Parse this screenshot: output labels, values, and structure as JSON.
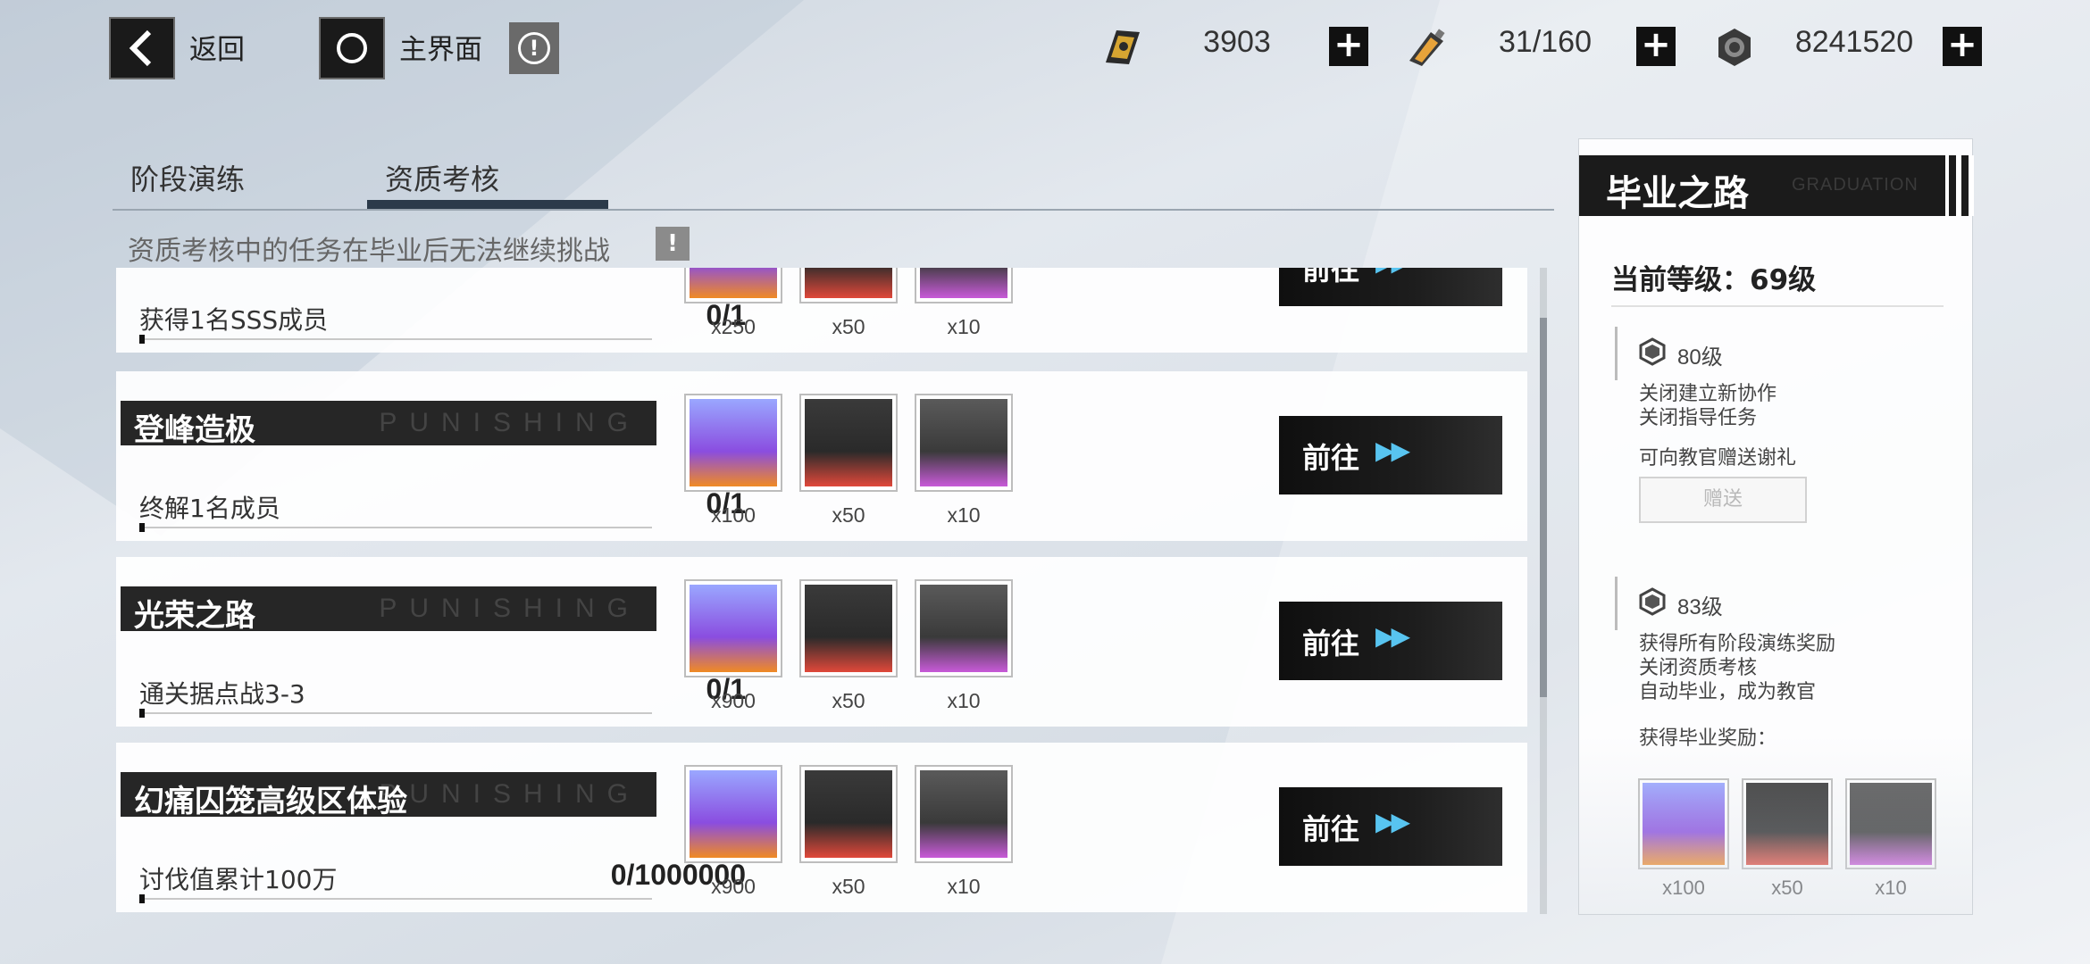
{
  "topbar": {
    "back_label": "返回",
    "home_label": "主界面",
    "resources": [
      {
        "icon": "ticket-icon",
        "value": "3903"
      },
      {
        "icon": "battery-icon",
        "value": "31/160"
      },
      {
        "icon": "gear-coin-icon",
        "value": "8241520"
      }
    ]
  },
  "tabs": [
    {
      "label": "阶段演练",
      "active": false
    },
    {
      "label": "资质考核",
      "active": true
    }
  ],
  "notice": "资质考核中的任务在毕业后无法继续挑战",
  "tasks": [
    {
      "title": "",
      "desc": "获得1名SSS成员",
      "progress": "0/1",
      "rewards": [
        "x250",
        "x50",
        "x10"
      ],
      "button": "前往"
    },
    {
      "title": "登峰造极",
      "deco": "PUNISHING",
      "desc": "终解1名成员",
      "progress": "0/1",
      "rewards": [
        "x100",
        "x50",
        "x10"
      ],
      "button": "前往"
    },
    {
      "title": "光荣之路",
      "deco": "PUNISHING",
      "desc": "通关据点战3-3",
      "progress": "0/1",
      "rewards": [
        "x900",
        "x50",
        "x10"
      ],
      "button": "前往"
    },
    {
      "title": "幻痛囚笼高级区体验",
      "deco": "PUNISHING",
      "desc": "讨伐值累计100万",
      "progress": "0/1000000",
      "rewards": [
        "x900",
        "x50",
        "x10"
      ],
      "button": "前往"
    }
  ],
  "graduation": {
    "title": "毕业之路",
    "subtitle": "GRADUATION",
    "current_level": "当前等级：69级",
    "milestones": [
      {
        "level": "80级",
        "perks": [
          "关闭建立新协作",
          "关闭指导任务"
        ],
        "note": "可向教官赠送谢礼",
        "button": "赠送"
      },
      {
        "level": "83级",
        "perks": [
          "获得所有阶段演练奖励",
          "关闭资质考核",
          "自动毕业，成为教官"
        ],
        "note": "获得毕业奖励："
      }
    ],
    "rewards": [
      "x100",
      "x50",
      "x10"
    ]
  },
  "colors": {
    "accent_blue": "#58c4f0",
    "supply_orange": "#f08a24",
    "supply_red": "#e0483a",
    "supply_purple": "#c85ad8",
    "dark": "#1b1b1b"
  }
}
